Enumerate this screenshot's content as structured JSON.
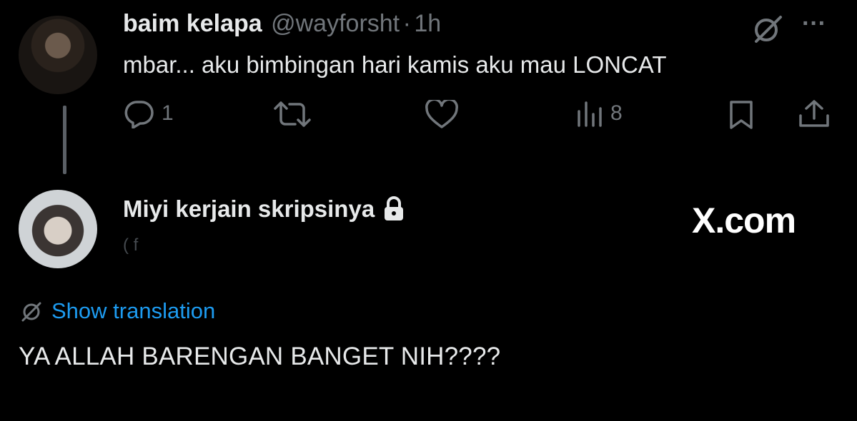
{
  "tweet": {
    "author_name": "baim kelapa",
    "author_handle": "@wayforsht",
    "separator": "·",
    "time": "1h",
    "text": "mbar... aku bimbingan hari kamis aku mau LONCAT",
    "more_label": "···",
    "actions": {
      "reply_count": "1",
      "views_count": "8"
    },
    "icons": [
      "no-translate-icon",
      "reply-icon",
      "retweet-icon",
      "like-icon",
      "views-icon",
      "bookmark-icon",
      "share-icon"
    ]
  },
  "reply": {
    "author_name": "Miyi kerjain skripsinya",
    "lock_icon": "lock-icon",
    "handle_obscured": "( f",
    "translation_label": "Show translation",
    "text": "YA ALLAH BARENGAN BANGET NIH????"
  },
  "watermark": "X.com",
  "colors": {
    "background": "#000000",
    "text": "#e7e9ea",
    "muted": "#71767b",
    "link": "#1d9bf0",
    "thread_line": "#5b6066"
  }
}
